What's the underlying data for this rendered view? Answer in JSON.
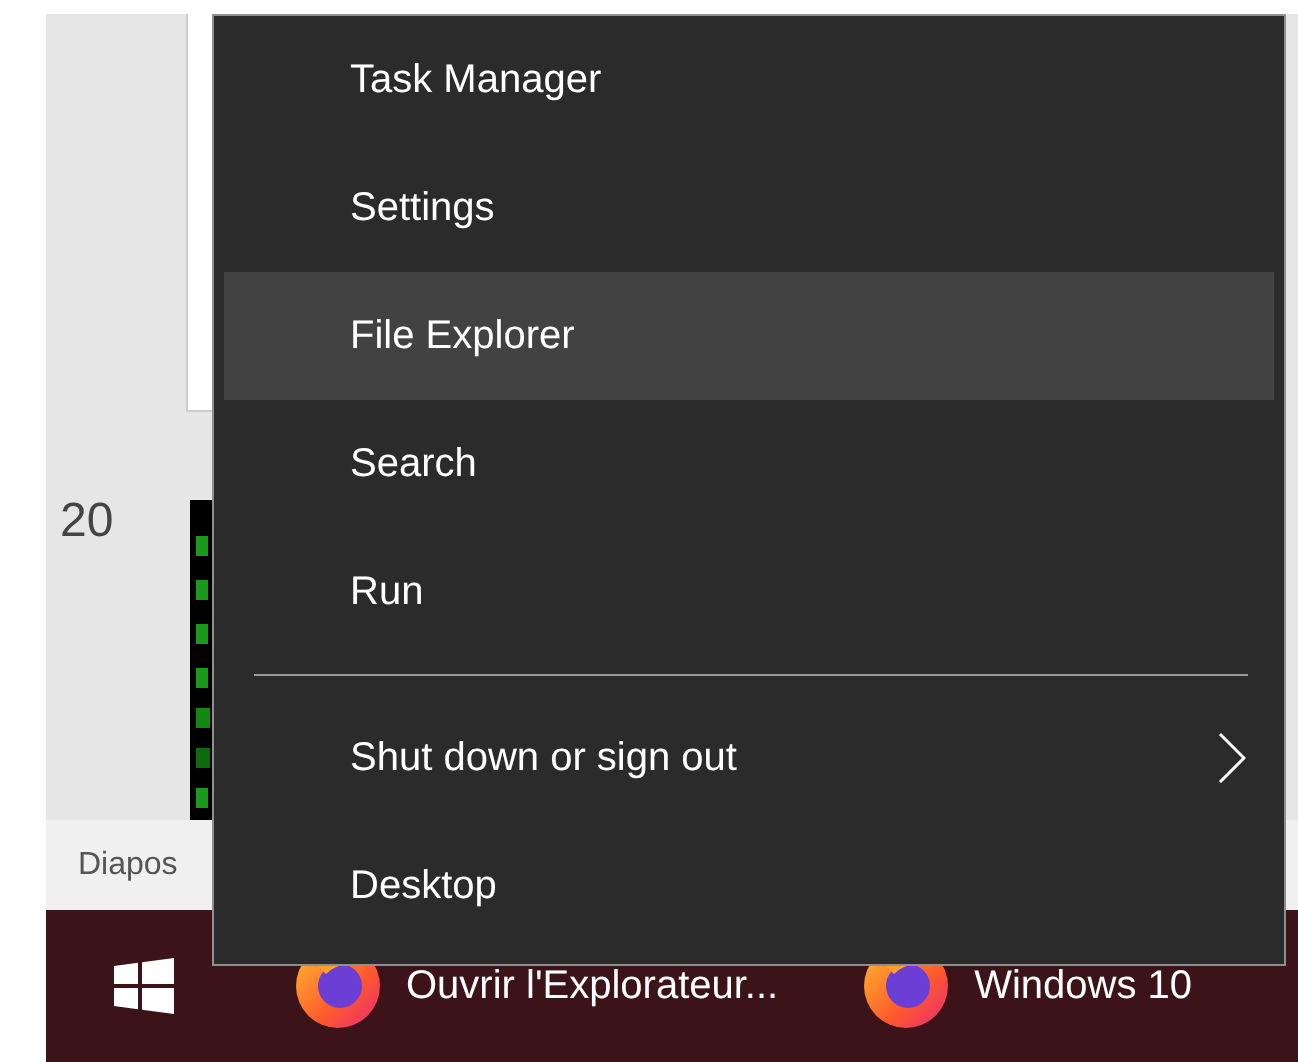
{
  "background_window": {
    "line_number": "20",
    "status_text": "Diapos"
  },
  "context_menu": {
    "items": [
      {
        "kind": "item",
        "label": "Task Manager",
        "selected": false,
        "has_submenu": false
      },
      {
        "kind": "item",
        "label": "Settings",
        "selected": false,
        "has_submenu": false
      },
      {
        "kind": "item",
        "label": "File Explorer",
        "selected": true,
        "has_submenu": false
      },
      {
        "kind": "item",
        "label": "Search",
        "selected": false,
        "has_submenu": false
      },
      {
        "kind": "item",
        "label": "Run",
        "selected": false,
        "has_submenu": false
      },
      {
        "kind": "separator"
      },
      {
        "kind": "item",
        "label": "Shut down or sign out",
        "selected": false,
        "has_submenu": true
      },
      {
        "kind": "item",
        "label": "Desktop",
        "selected": false,
        "has_submenu": false
      }
    ]
  },
  "taskbar": {
    "buttons": [
      {
        "label": "Ouvrir l'Explorateur..."
      },
      {
        "label": "Windows 10"
      }
    ]
  }
}
